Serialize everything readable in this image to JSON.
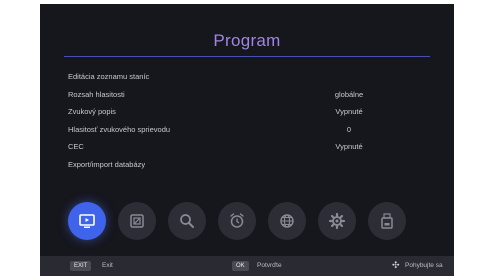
{
  "title": "Program",
  "menu": [
    {
      "label": "Editácia zoznamu staníc",
      "value": ""
    },
    {
      "label": "Rozsah hlasitosti",
      "value": "globálne"
    },
    {
      "label": "Zvukový popis",
      "value": "Vypnuté"
    },
    {
      "label": "Hlasitosť zvukového sprievodu",
      "value": "0"
    },
    {
      "label": "CEC",
      "value": "Vypnuté"
    },
    {
      "label": "Export/import databázy",
      "value": ""
    }
  ],
  "icons": [
    {
      "name": "program-tv-icon",
      "active": true
    },
    {
      "name": "picture-icon",
      "active": false
    },
    {
      "name": "search-icon",
      "active": false
    },
    {
      "name": "timer-clock-icon",
      "active": false
    },
    {
      "name": "network-globe-icon",
      "active": false
    },
    {
      "name": "settings-gear-icon",
      "active": false
    },
    {
      "name": "usb-storage-icon",
      "active": false
    }
  ],
  "footer": {
    "exit_key": "EXIT",
    "exit_label": "Exit",
    "ok_key": "OK",
    "ok_label": "Potvrďte",
    "move_label": "Pohybujte sa"
  },
  "colors": {
    "accent": "#3f63ea",
    "title": "#9f85e6",
    "background": "#16161d"
  }
}
